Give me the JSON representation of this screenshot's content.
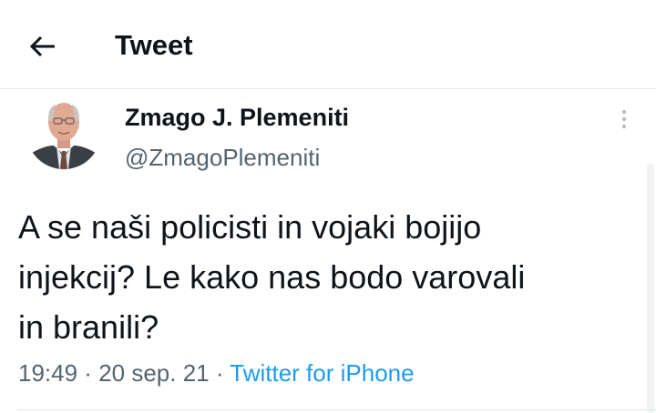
{
  "header": {
    "title": "Tweet",
    "back_icon": "arrow-left-icon"
  },
  "tweet": {
    "author": {
      "display_name": "Zmago J. Plemeniti",
      "handle": "@ZmagoPlemeniti",
      "avatar_icon": "avatar"
    },
    "text": "A se naši policisti in vojaki bojijo\ninjekcij? Le kako nas bodo varovali\nin branili?",
    "time": "19:49",
    "separator": " · ",
    "date": "20 sep. 21",
    "source": "Twitter for iPhone",
    "more_icon": "more-vertical-icon"
  },
  "colors": {
    "text_primary": "#0f1419",
    "text_secondary": "#536471",
    "link": "#1d9bf0",
    "divider": "#e1e6ea"
  }
}
